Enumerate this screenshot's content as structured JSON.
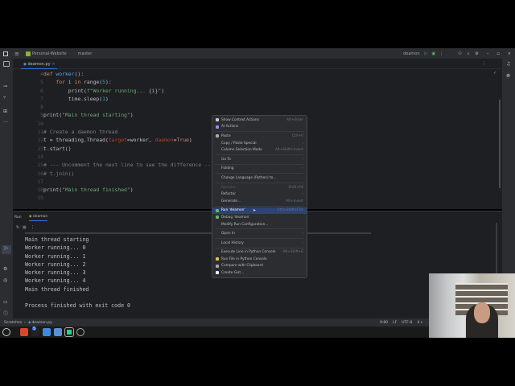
{
  "titlebar": {
    "project": "Personal-Website",
    "branch": "master",
    "run_config": "deamon"
  },
  "tab": {
    "file": "deamon.py"
  },
  "editor": {
    "lines": [
      {
        "n": "4",
        "html": "<span class='kw'>def</span> <span class='fn'>worker</span>():"
      },
      {
        "n": "5",
        "html": "    <span class='kw'>for</span> i <span class='kw'>in</span> range(<span class='nm'>5</span>):"
      },
      {
        "n": "6",
        "html": "        print(<span class='st'>f\"Worker running... </span>{i}<span class='st'>\"</span>)"
      },
      {
        "n": "7",
        "html": "        time.sleep(<span class='nm'>1</span>)"
      },
      {
        "n": "8",
        "html": ""
      },
      {
        "n": "9",
        "html": "print(<span class='st'>\"Main thread starting\"</span>)"
      },
      {
        "n": "10",
        "html": ""
      },
      {
        "n": "11",
        "html": "<span class='cm'># Create a daemon thread</span>"
      },
      {
        "n": "12",
        "html": "t = threading.Thread(<span class='pr'>target</span>=worker, <span class='pr'>daemon</span>=<span class='kw'>True</span>)"
      },
      {
        "n": "13",
        "html": "t.start()"
      },
      {
        "n": "14",
        "html": ""
      },
      {
        "n": "15",
        "html": "<span class='cm'># --- Uncomment the next line to see the difference ---</span>"
      },
      {
        "n": "16",
        "html": "<span class='cm'># t.join()</span>"
      },
      {
        "n": "17",
        "html": ""
      },
      {
        "n": "18",
        "html": "print(<span class='st'>\"Main thread finished\"</span>)"
      },
      {
        "n": "19",
        "html": ""
      }
    ]
  },
  "run": {
    "tab_title": "Run",
    "config_tab": "deamon",
    "output": [
      "Main thread starting",
      "Worker running... 0",
      "Worker running... 1",
      "Worker running... 2",
      "Worker running... 3",
      "Worker running... 4",
      "Main thread finished",
      "",
      "Process finished with exit code 0"
    ]
  },
  "menu": [
    {
      "label": "Show Context Actions",
      "sc": "Alt+Enter",
      "icon": "bulb"
    },
    {
      "label": "AI Actions",
      "icon": "ai"
    },
    {
      "sep": true
    },
    {
      "label": "Paste",
      "sc": "Ctrl+V",
      "icon": "paste"
    },
    {
      "label": "Copy / Paste Special",
      "sub": true
    },
    {
      "label": "Column Selection Mode",
      "sc": "Alt+Shift+Insert"
    },
    {
      "sep": true
    },
    {
      "label": "Go To",
      "sub": true
    },
    {
      "sep": true
    },
    {
      "label": "Folding",
      "sub": true
    },
    {
      "sep": true
    },
    {
      "label": "Change Language (Python) to..."
    },
    {
      "sep": true
    },
    {
      "label": "Rename...",
      "sc": "Shift+F6",
      "dis": true
    },
    {
      "label": "Refactor",
      "sub": true
    },
    {
      "label": "Generate...",
      "sc": "Alt+Insert"
    },
    {
      "sep": true
    },
    {
      "label": "Run 'deamon'",
      "sc": "Ctrl+Shift+F10",
      "sel": true,
      "icon": "run"
    },
    {
      "label": "Debug 'deamon'",
      "icon": "debug"
    },
    {
      "label": "Modify Run Configuration..."
    },
    {
      "sep": true
    },
    {
      "label": "Open In",
      "sub": true
    },
    {
      "sep": true
    },
    {
      "label": "Local History",
      "sub": true
    },
    {
      "sep": true
    },
    {
      "label": "Execute Line in Python Console",
      "sc": "Alt+Shift+E"
    },
    {
      "label": "Run File in Python Console",
      "icon": "python"
    },
    {
      "label": "Compare with Clipboard",
      "icon": "compare"
    },
    {
      "label": "Create Gist...",
      "icon": "github"
    }
  ],
  "status": {
    "breadcrumb_root": "Scratches",
    "breadcrumb_file": "deamon.py",
    "position": "9:80",
    "line_sep": "LF",
    "encoding": "UTF-8",
    "indent": "4 s"
  },
  "taskbar": {
    "badge": "5"
  }
}
